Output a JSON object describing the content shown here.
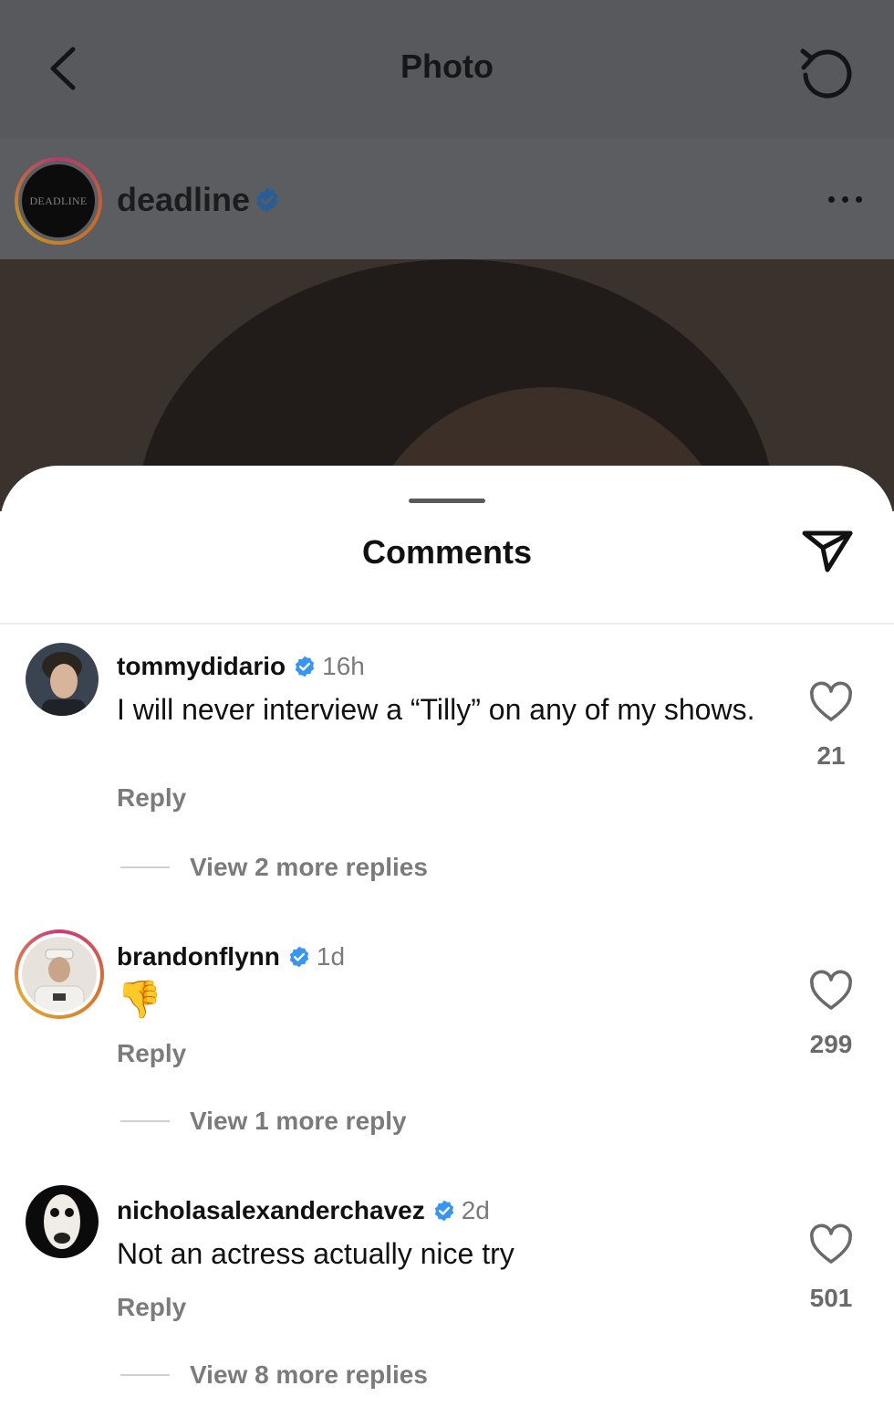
{
  "background": {
    "page_title": "Photo",
    "post": {
      "username": "deadline",
      "avatar_text": "DEADLINE",
      "verified": true
    },
    "icons": {
      "back": "chevron-left-icon",
      "refresh": "refresh-icon",
      "more": "more-dots-icon"
    }
  },
  "sheet": {
    "title": "Comments",
    "share_icon": "send-icon"
  },
  "comments": [
    {
      "username": "tommydidario",
      "verified": true,
      "time": "16h",
      "text": "I will never interview a “Tilly” on any of my shows.",
      "reply_label": "Reply",
      "view_replies": "View 2 more replies",
      "likes": "21"
    },
    {
      "username": "brandonflynn",
      "verified": true,
      "time": "1d",
      "text": "👎",
      "reply_label": "Reply",
      "view_replies": "View 1 more reply",
      "likes": "299"
    },
    {
      "username": "nicholasalexanderchavez",
      "verified": true,
      "time": "2d",
      "text": "Not an actress actually nice try",
      "reply_label": "Reply",
      "view_replies": "View 8 more replies",
      "likes": "501"
    }
  ],
  "colors": {
    "verified_blue": "#3797f0",
    "overlay_gray": "#58595c",
    "secondary_text": "#7b7b7b"
  }
}
